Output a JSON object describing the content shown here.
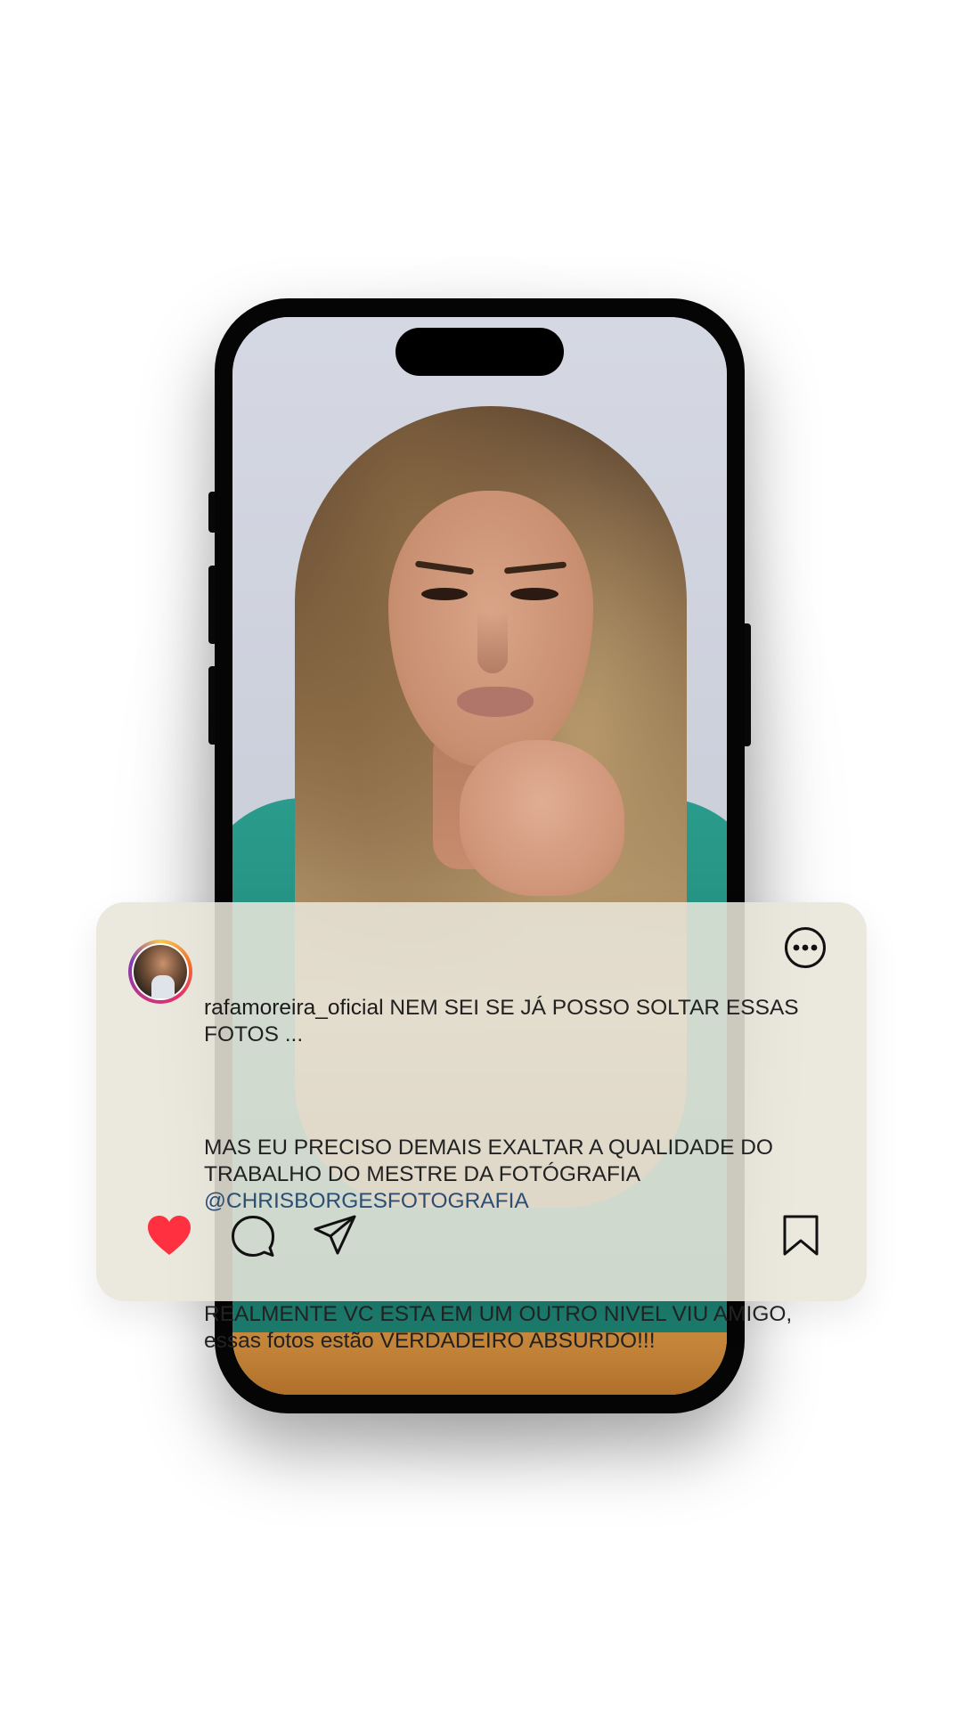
{
  "post": {
    "username": "rafamoreira_oficial",
    "caption_lines": {
      "p1": "NEM SEI SE JÁ POSSO SOLTAR ESSAS FOTOS ...",
      "p2": "MAS EU PRECISO DEMAIS EXALTAR A QUALIDADE DO TRABALHO DO MESTRE DA FOTÓGRAFIA",
      "mention": "@CHRISBORGESFOTOGRAFIA",
      "p3": "REALMENTE VC ESTA EM UM OUTRO NIVEL VIU AMIGO, essas fotos estão VERDADEIRO ABSURDO!!!"
    },
    "liked": true
  },
  "icons": {
    "like": "heart-icon",
    "comment": "comment-icon",
    "share": "send-icon",
    "save": "bookmark-icon",
    "more": "more-options-icon"
  },
  "colors": {
    "card_background": "#e8e5da",
    "like_red": "#ff3040",
    "mention_blue": "#2d4e73",
    "text": "#222222",
    "shirt_teal": "#2a9b8c"
  }
}
